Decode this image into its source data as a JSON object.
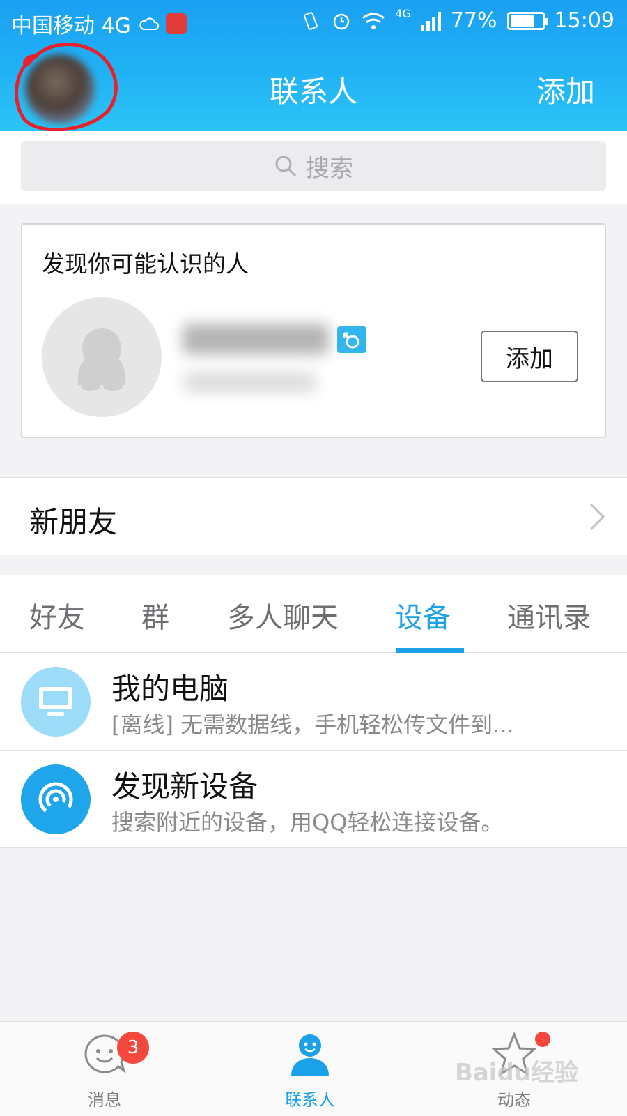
{
  "status_bar": {
    "carrier": "中国移动 4G",
    "network_badge": "4G",
    "battery": "77%",
    "battery_level": 0.77,
    "time": "15:09"
  },
  "header": {
    "title": "联系人",
    "add_label": "添加"
  },
  "search": {
    "placeholder": "搜索"
  },
  "discover": {
    "title": "发现你可能认识的人",
    "add_label": "添加"
  },
  "new_friends": {
    "label": "新朋友"
  },
  "tabs": [
    {
      "label": "好友",
      "active": false
    },
    {
      "label": "群",
      "active": false
    },
    {
      "label": "多人聊天",
      "active": false
    },
    {
      "label": "设备",
      "active": true
    },
    {
      "label": "通讯录",
      "active": false
    }
  ],
  "devices": [
    {
      "title": "我的电脑",
      "subtitle": "[离线] 无需数据线，手机轻松传文件到...",
      "icon": "monitor-icon"
    },
    {
      "title": "发现新设备",
      "subtitle": "搜索附近的设备，用QQ轻松连接设备。",
      "icon": "radar-icon"
    }
  ],
  "bottom_nav": [
    {
      "label": "消息",
      "badge": "3",
      "icon": "message-smile-icon"
    },
    {
      "label": "联系人",
      "icon": "contacts-icon",
      "active": true
    },
    {
      "label": "动态",
      "icon": "star-icon",
      "dot": true
    }
  ],
  "watermark": "Baidu经验",
  "colors": {
    "accent": "#1aa1e8",
    "header_blue": "#21b2f5",
    "badge_red": "#f4473d"
  }
}
